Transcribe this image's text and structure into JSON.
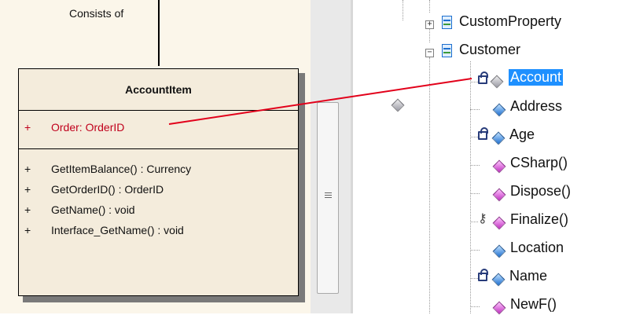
{
  "diagram": {
    "association_label": "Consists of",
    "class": {
      "name": "AccountItem",
      "attribute": {
        "visibility": "+",
        "text": "Order:  OrderID"
      },
      "operations": [
        {
          "visibility": "+",
          "text": "GetItemBalance() : Currency"
        },
        {
          "visibility": "+",
          "text": "GetOrderID() : OrderID"
        },
        {
          "visibility": "+",
          "text": "GetName() : void"
        },
        {
          "visibility": "+",
          "text": "Interface_GetName() : void"
        }
      ]
    },
    "connector_color": "#e2001a"
  },
  "scrollbar": {
    "grip_icon": "grip-lines-icon"
  },
  "tree": {
    "nodes": [
      {
        "label": "CustomProperty",
        "icon": "class-icon",
        "expander": "+"
      },
      {
        "label": "Customer",
        "icon": "class-icon",
        "expander": "−"
      }
    ],
    "members": [
      {
        "label": "Account",
        "icon": "gray-diamond-icon",
        "marker": "lock-icon",
        "selected": true
      },
      {
        "label": "Address",
        "icon": "blue-diamond-icon",
        "marker": ""
      },
      {
        "label": "Age",
        "icon": "blue-diamond-icon",
        "marker": "lock-icon"
      },
      {
        "label": "CSharp()",
        "icon": "pink-diamond-icon",
        "marker": ""
      },
      {
        "label": "Dispose()",
        "icon": "pink-diamond-icon",
        "marker": ""
      },
      {
        "label": "Finalize()",
        "icon": "pink-diamond-icon",
        "marker": "key-icon"
      },
      {
        "label": "Location",
        "icon": "blue-diamond-icon",
        "marker": ""
      },
      {
        "label": "Name",
        "icon": "blue-diamond-icon",
        "marker": "lock-icon"
      },
      {
        "label": "NewF()",
        "icon": "pink-diamond-icon",
        "marker": ""
      }
    ]
  }
}
